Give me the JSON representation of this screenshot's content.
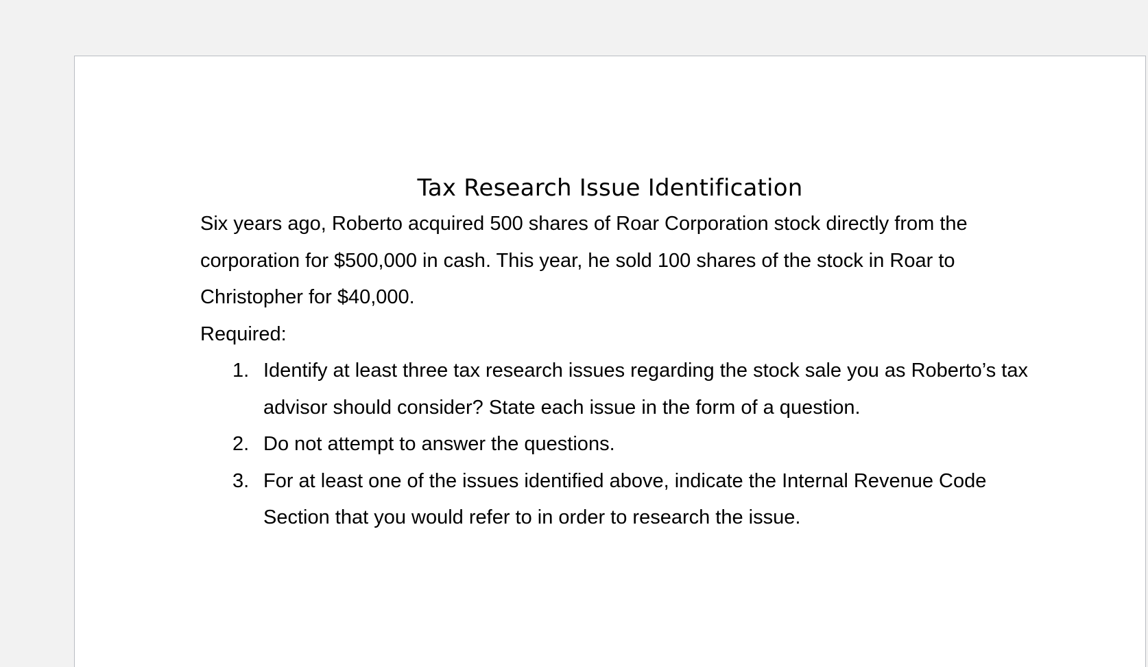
{
  "document": {
    "title": "Tax Research Issue Identification",
    "intro": "Six years ago, Roberto acquired 500 shares of Roar Corporation stock directly from the corporation for $500,000 in cash. This year, he sold 100 shares of the stock in Roar to Christopher for $40,000.",
    "required_label": "Required:",
    "items": [
      {
        "number": "1.",
        "text": "Identify at least three tax research issues regarding the stock sale you as Roberto’s tax advisor should consider? State each issue in the form of a question."
      },
      {
        "number": "2.",
        "text": "Do not attempt to answer the questions."
      },
      {
        "number": "3.",
        "text": "For at least one of the issues identified above, indicate the Internal Revenue Code Section that you would refer to in order to research the issue."
      }
    ]
  },
  "colors": {
    "workspace_background": "#f2f2f2",
    "page_background": "#ffffff",
    "page_border": "#b9bcc2",
    "text": "#000000"
  }
}
